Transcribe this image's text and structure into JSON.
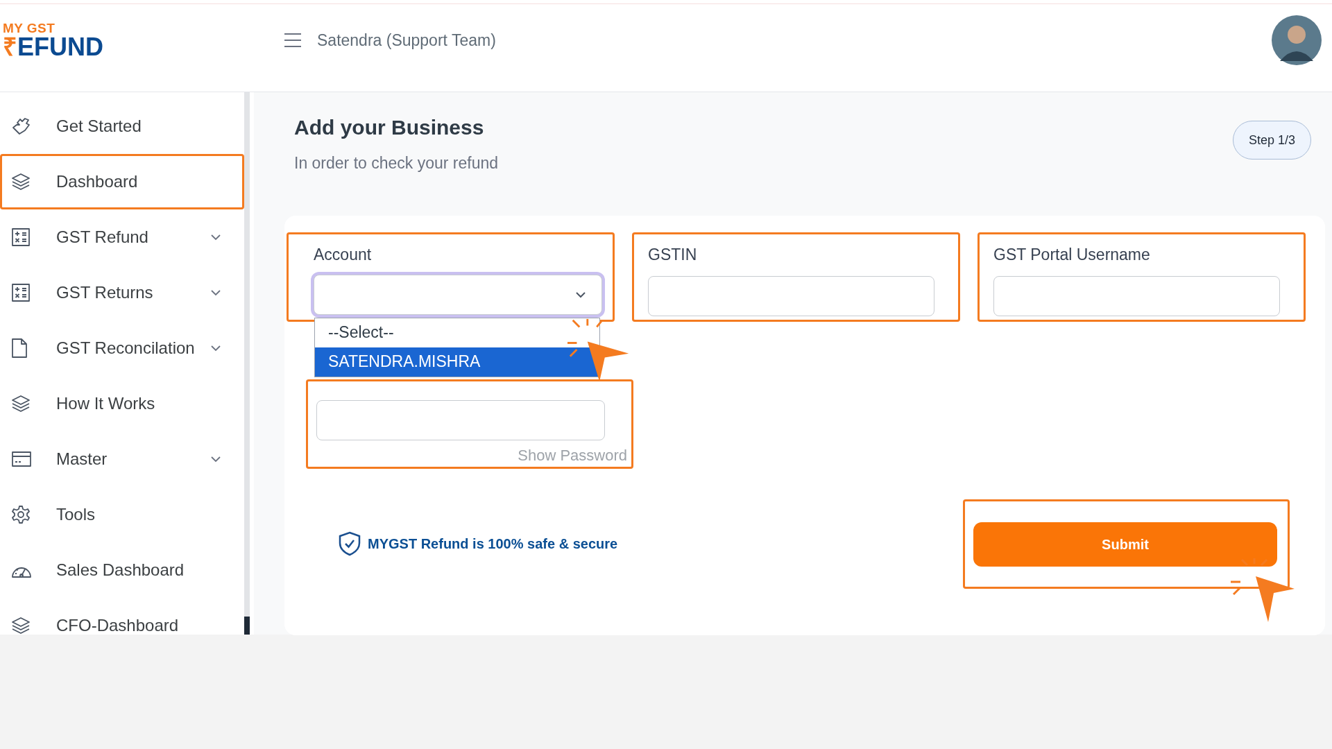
{
  "logo": {
    "tagline": "MY GST",
    "symbol": "₹",
    "word": "EFUND"
  },
  "header": {
    "user": "Satendra (Support Team)"
  },
  "sidebar": {
    "items": [
      {
        "label": "Get Started",
        "expandable": false,
        "selected": false
      },
      {
        "label": "Dashboard",
        "expandable": false,
        "selected": true
      },
      {
        "label": "GST Refund",
        "expandable": true,
        "selected": false
      },
      {
        "label": "GST Returns",
        "expandable": true,
        "selected": false
      },
      {
        "label": "GST Reconcilation",
        "expandable": true,
        "selected": false
      },
      {
        "label": "How It Works",
        "expandable": false,
        "selected": false
      },
      {
        "label": "Master",
        "expandable": true,
        "selected": false
      },
      {
        "label": "Tools",
        "expandable": false,
        "selected": false
      },
      {
        "label": "Sales Dashboard",
        "expandable": false,
        "selected": false
      },
      {
        "label": "CFO-Dashboard",
        "expandable": false,
        "selected": false
      }
    ]
  },
  "page": {
    "title": "Add your Business",
    "subtitle": "In order to check your refund",
    "step": "Step 1/3"
  },
  "form": {
    "fields": [
      {
        "kind": "select",
        "label": "Account",
        "focused": true,
        "expanded": true,
        "options": [
          {
            "label": "--Select--",
            "selected": false
          },
          {
            "label": "SATENDRA.MISHRA",
            "selected": true
          }
        ]
      },
      {
        "kind": "text",
        "label": "GSTIN",
        "focused": false
      },
      {
        "kind": "text",
        "label": "GST Portal Username",
        "focused": false
      }
    ],
    "password": {
      "toggle": "Show Password"
    },
    "secure_note": "MYGST Refund is 100% safe & secure",
    "submit": "Submit"
  }
}
